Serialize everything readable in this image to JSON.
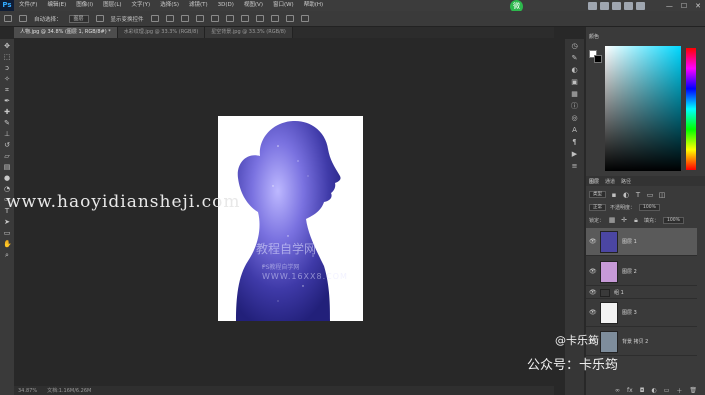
{
  "app": {
    "logo": "Ps"
  },
  "menubar": {
    "items": [
      "文件(F)",
      "编辑(E)",
      "图像(I)",
      "图层(L)",
      "文字(Y)",
      "选择(S)",
      "滤镜(T)",
      "3D(D)",
      "视图(V)",
      "窗口(W)",
      "帮助(H)"
    ]
  },
  "tray": {
    "wechat_label": "微"
  },
  "window_controls": {
    "minimize": "—",
    "maximize": "☐",
    "close": "✕"
  },
  "options_bar": {
    "auto_select_label": "自动选择：",
    "auto_select_value": "图层",
    "show_transform_label": "显示变换控件"
  },
  "tabs": [
    {
      "label": "人物.jpg @ 34.8% (图层 1, RGB/8#) *",
      "active": true
    },
    {
      "label": "水彩纹理.jpg @ 33.3% (RGB/8)",
      "active": false
    },
    {
      "label": "星空背景.jpg @ 33.3% (RGB/8)",
      "active": false
    }
  ],
  "toolbox": {
    "tools": [
      "move-icon",
      "marquee-icon",
      "lasso-icon",
      "quick-select-icon",
      "crop-icon",
      "eyedropper-icon",
      "healing-icon",
      "brush-icon",
      "stamp-icon",
      "history-brush-icon",
      "eraser-icon",
      "gradient-icon",
      "blur-icon",
      "dodge-icon",
      "pen-icon",
      "type-icon",
      "path-select-icon",
      "shape-icon",
      "hand-icon",
      "zoom-icon"
    ]
  },
  "canvas": {
    "watermark_url": "www.haoyidiansheji.com",
    "cn_watermark_title": "教程自学网",
    "cn_watermark_sub": "PS教程自学网",
    "cn_watermark_url": "WWW.16XX8.COM"
  },
  "statusbar": {
    "zoom": "34.87%",
    "doc_info": "文档:1.16M/6.26M"
  },
  "color_panel": {
    "tab": "颜色",
    "accent_hex": "#00d8ff"
  },
  "layers_panel": {
    "tabs": [
      "图层",
      "通道",
      "路径"
    ],
    "filter_label": "类型",
    "blend_mode": "正常",
    "opacity_label": "不透明度：",
    "opacity_value": "100%",
    "lock_label": "锁定：",
    "fill_label": "填充：",
    "fill_value": "100%",
    "layers": [
      {
        "name": "图层 1",
        "visible": true,
        "active": true,
        "thumb": "#4b46a3"
      },
      {
        "name": "图层 2",
        "visible": true,
        "active": false,
        "thumb": "#c79ad8"
      },
      {
        "name": "组 1",
        "visible": true,
        "active": false,
        "thumb": "#3a3a3a"
      },
      {
        "name": "图层 3",
        "visible": true,
        "active": false,
        "thumb": "#f2f2f2"
      },
      {
        "name": "背景 拷贝 2",
        "visible": true,
        "active": false,
        "thumb": "#7e8d9c"
      }
    ]
  },
  "overlay": {
    "author": "@卡乐筠",
    "account": "公众号：卡乐筠"
  }
}
